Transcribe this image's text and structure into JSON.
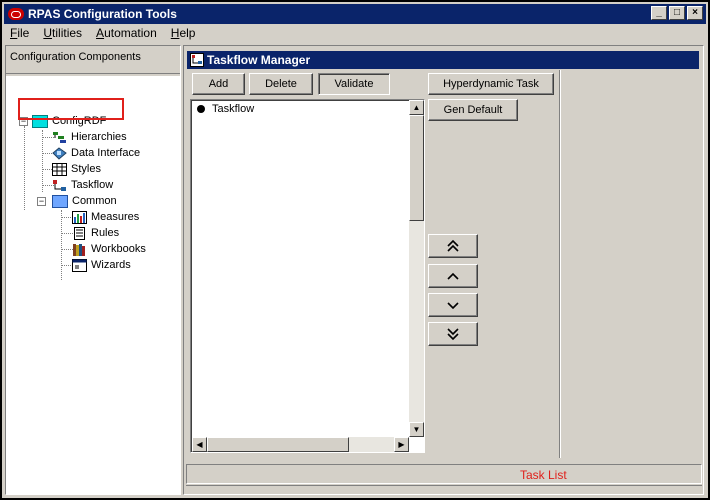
{
  "window": {
    "title": "RPAS Configuration Tools"
  },
  "menu": [
    {
      "label": "File",
      "accel": "F",
      "rest": "ile"
    },
    {
      "label": "Utilities",
      "accel": "U",
      "rest": "tilities"
    },
    {
      "label": "Automation",
      "accel": "A",
      "rest": "utomation"
    },
    {
      "label": "Help",
      "accel": "H",
      "rest": "elp"
    }
  ],
  "left_panel": {
    "header": "Configuration Components",
    "tree": {
      "root": "ConfigRDF",
      "items": [
        "Hierarchies",
        "Data Interface",
        "Styles",
        "Taskflow"
      ],
      "common": "Common",
      "common_items": [
        "Measures",
        "Rules",
        "Workbooks",
        "Wizards"
      ]
    },
    "highlighted_item": "Taskflow"
  },
  "taskflow_manager": {
    "title": "Taskflow Manager",
    "buttons": {
      "add": "Add",
      "delete": "Delete",
      "validate": "Validate",
      "hyperdynamic": "Hyperdynamic Task",
      "gen_default": "Gen Default"
    },
    "list_items": [
      "Taskflow"
    ]
  },
  "task_list": {
    "label": "Task List"
  },
  "colors": {
    "title_bar": "#0a246a",
    "highlight": "#e0201b",
    "window_bg": "#d4d0c8"
  },
  "icons": [
    "window-minimize-icon",
    "window-restore-icon",
    "window-close-icon",
    "move-top-icon",
    "move-up-icon",
    "move-down-icon",
    "move-bottom-icon"
  ]
}
